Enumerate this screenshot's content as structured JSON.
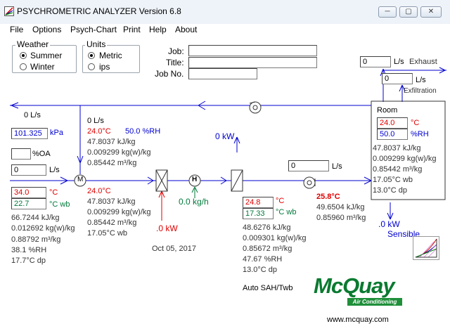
{
  "window": {
    "title": "PSYCHROMETRIC ANALYZER   Version 6.8",
    "min_label": "─",
    "max_label": "▢",
    "close_label": "✕"
  },
  "menu": [
    "File",
    "Options",
    "Psych-Chart",
    "Print",
    "Help",
    "About"
  ],
  "weather": {
    "legend": "Weather",
    "options": [
      "Summer",
      "Winter"
    ],
    "selected": "Summer"
  },
  "units": {
    "legend": "Units",
    "options": [
      "Metric",
      "ips"
    ],
    "selected": "Metric"
  },
  "job": {
    "job_label": "Job:",
    "title_label": "Title:",
    "jobno_label": "Job No.",
    "job_value": "",
    "title_value": "",
    "jobno_value": ""
  },
  "exhaust": {
    "value": "0",
    "unit": "L/s",
    "label": "Exhaust"
  },
  "exfiltration": {
    "value": "0",
    "unit": "L/s",
    "label": "Exfiltration"
  },
  "return_flow": "0 L/s",
  "mixed_flow": "0 L/s",
  "pressure": {
    "value": "101.325",
    "unit": "kPa"
  },
  "oa": {
    "value": "",
    "unit": "%OA"
  },
  "outdoor_flow": {
    "value": "0",
    "unit": "L/s"
  },
  "outdoor": {
    "db": "34.0",
    "db_unit": "°C",
    "wb": "22.7",
    "wb_unit": "°C wb",
    "enthalpy": "66.7244 kJ/kg",
    "humidity": "0.012692 kg(w)/kg",
    "volume": "0.88792 m³/kg",
    "rh": "38.1 %RH",
    "dp": "17.7°C dp"
  },
  "return_air": {
    "db": "24.0°C",
    "rh": "50.0 %RH",
    "enthalpy": "47.8037 kJ/kg",
    "humidity": "0.009299 kg(w)/kg",
    "volume": "0.85442 m³/kg"
  },
  "mixed": {
    "db": "24.0°C",
    "enthalpy": "47.8037 kJ/kg",
    "humidity": "0.009299 kg(w)/kg",
    "volume": "0.85442 m³/kg",
    "wb": "17.05°C wb"
  },
  "mixer_symbol": "M",
  "humidifier_symbol": "H",
  "preheat": {
    "power": ".0 kW"
  },
  "humidifier": {
    "rate": "0.0 kg/h"
  },
  "date": "Oct 05, 2017",
  "cooling": {
    "power": "0 kW",
    "db": "24.8",
    "db_unit": "°C",
    "wb": "17.33",
    "wb_unit": "°C wb",
    "enthalpy": "48.6276 kJ/kg",
    "humidity": "0.009301 kg(w)/kg",
    "volume": "0.85672 m³/kg",
    "rh": "47.67 %RH",
    "dp": "13.0°C dp",
    "note": "Auto SAH/Twb"
  },
  "supply_flow": {
    "value": "0",
    "unit": "L/s"
  },
  "supply": {
    "db": "25.8°C",
    "enthalpy": "49.6504 kJ/kg",
    "volume": "0.85960 m³/kg"
  },
  "room": {
    "label": "Room",
    "db": "24.0",
    "db_unit": "°C",
    "rh": "50.0",
    "rh_unit": "%RH",
    "enthalpy": "47.8037 kJ/kg",
    "humidity": "0.009299 kg(w)/kg",
    "volume": "0.85442 m³/kg",
    "wb": "17.05°C wb",
    "dp": "13.0°C dp"
  },
  "sensible": {
    "power": ".0 kW",
    "label": "Sensible"
  },
  "brand": {
    "name": "McQuay",
    "tagline": "Air Conditioning",
    "url": "www.mcquay.com"
  },
  "colors": {
    "line_blue": "#0000d0",
    "value_red": "#e00000",
    "value_green": "#007a3a",
    "brand_green": "#0a7a30",
    "brand_band": "#1f8f3a"
  }
}
